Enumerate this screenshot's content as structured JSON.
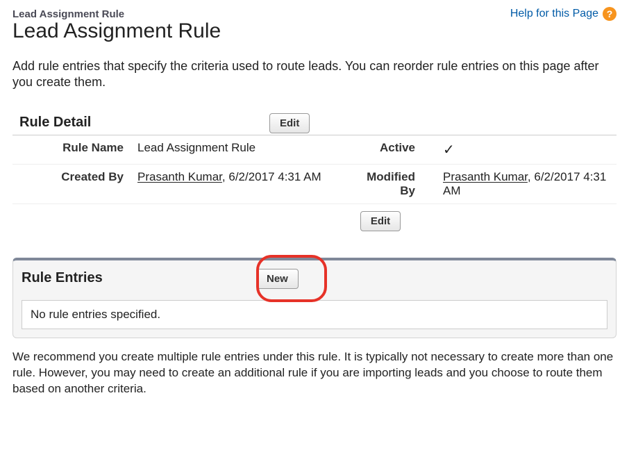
{
  "header": {
    "breadcrumb": "Lead Assignment Rule",
    "help_link": "Help for this Page"
  },
  "page_title": "Lead Assignment Rule",
  "intro_text": "Add rule entries that specify the criteria used to route leads. You can reorder rule entries on this page after you create them.",
  "detail": {
    "section_title": "Rule Detail",
    "edit_label": "Edit",
    "rule_name_label": "Rule Name",
    "rule_name_value": "Lead Assignment Rule",
    "active_label": "Active",
    "created_by_label": "Created By",
    "created_by_user": "Prasanth Kumar",
    "created_by_time": "6/2/2017 4:31 AM",
    "modified_by_label": "Modified By",
    "modified_by_user": "Prasanth Kumar",
    "modified_by_time": "6/2/2017 4:31 AM"
  },
  "entries": {
    "section_title": "Rule Entries",
    "new_label": "New",
    "empty_text": "No rule entries specified."
  },
  "bottom_text": "We recommend you create multiple rule entries under this rule. It is typically not necessary to create more than one rule. However, you may need to create an additional rule if you are importing leads and you choose to route them based on another criteria."
}
